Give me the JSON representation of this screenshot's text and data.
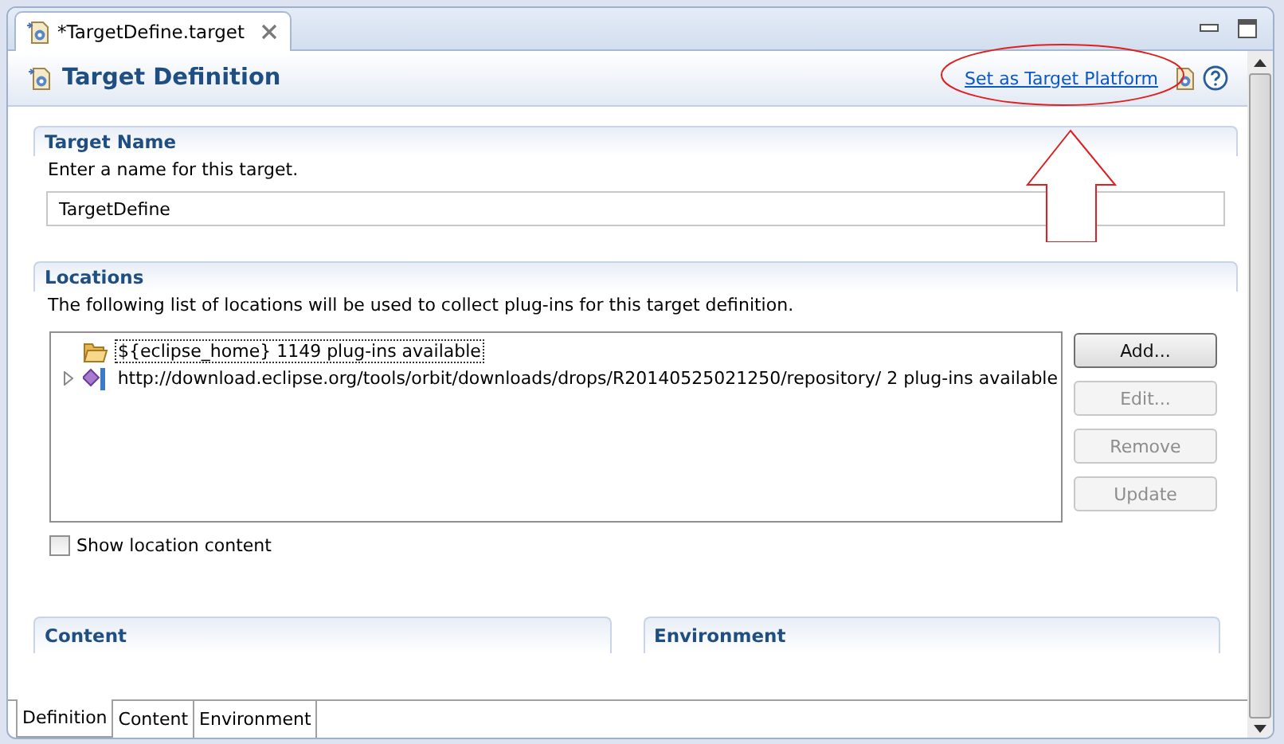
{
  "editor_tab": {
    "title": "*TargetDefine.target",
    "selected": true
  },
  "header": {
    "title": "Target Definition",
    "link": "Set as Target Platform"
  },
  "target_name": {
    "title": "Target Name",
    "description": "Enter a name for this target.",
    "value": "TargetDefine"
  },
  "locations": {
    "title": "Locations",
    "description": "The following list of locations will be used to collect plug-ins for this target definition.",
    "items": [
      {
        "kind": "folder",
        "label": "${eclipse_home} 1149 plug-ins available",
        "expandable": false,
        "selected": true
      },
      {
        "kind": "repository",
        "label": "http://download.eclipse.org/tools/orbit/downloads/drops/R20140525021250/repository/ 2 plug-ins available",
        "expandable": true,
        "selected": false
      }
    ],
    "buttons": [
      {
        "label": "Add...",
        "disabled": false
      },
      {
        "label": "Edit...",
        "disabled": true
      },
      {
        "label": "Remove",
        "disabled": true
      },
      {
        "label": "Update",
        "disabled": true
      }
    ],
    "show_content": {
      "label": "Show location content",
      "checked": false
    }
  },
  "sections": [
    {
      "title": "Content"
    },
    {
      "title": "Environment"
    }
  ],
  "bottom_tabs": [
    {
      "label": "Definition",
      "selected": true
    },
    {
      "label": "Content",
      "selected": false
    },
    {
      "label": "Environment",
      "selected": false
    }
  ]
}
